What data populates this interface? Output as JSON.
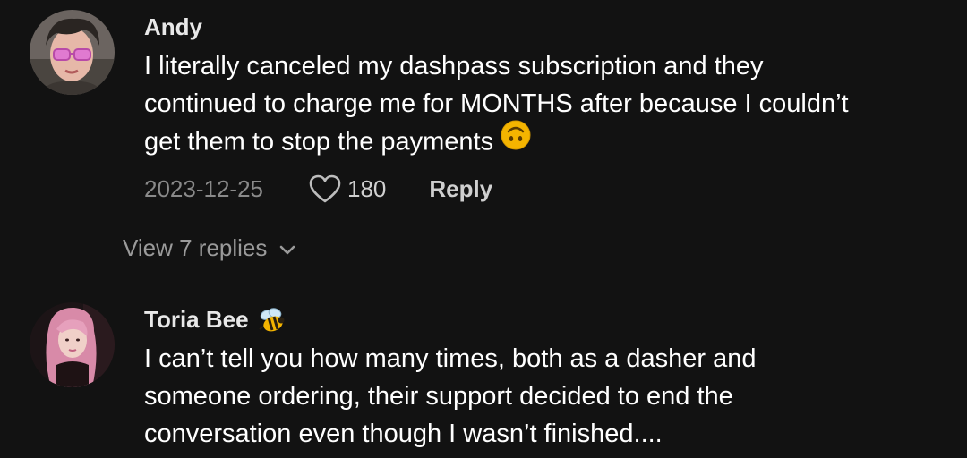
{
  "comments": [
    {
      "username": "Andy",
      "avatar_icon": "user-avatar-icon",
      "text_lines": [
        "I literally canceled my dashpass subscription and they",
        "continued to charge me for MONTHS after because I couldn’t",
        "get them to stop the payments"
      ],
      "emoji_icon": "upside-down-face-emoji",
      "date": "2023-12-25",
      "like_count": "180",
      "reply_label": "Reply",
      "view_replies_label": "View 7 replies"
    },
    {
      "username": "Toria Bee",
      "badge_icon": "bee-emoji",
      "avatar_icon": "user-avatar-icon",
      "text_lines": [
        "I can’t tell you how many times, both as a dasher and",
        "someone ordering, their support decided to end the",
        "conversation even though I wasn’t finished...."
      ]
    }
  ],
  "colors": {
    "background": "#121212",
    "primary_text": "#ffffff",
    "secondary_text": "#8a8a8a",
    "emoji_yellow": "#f4b400"
  }
}
